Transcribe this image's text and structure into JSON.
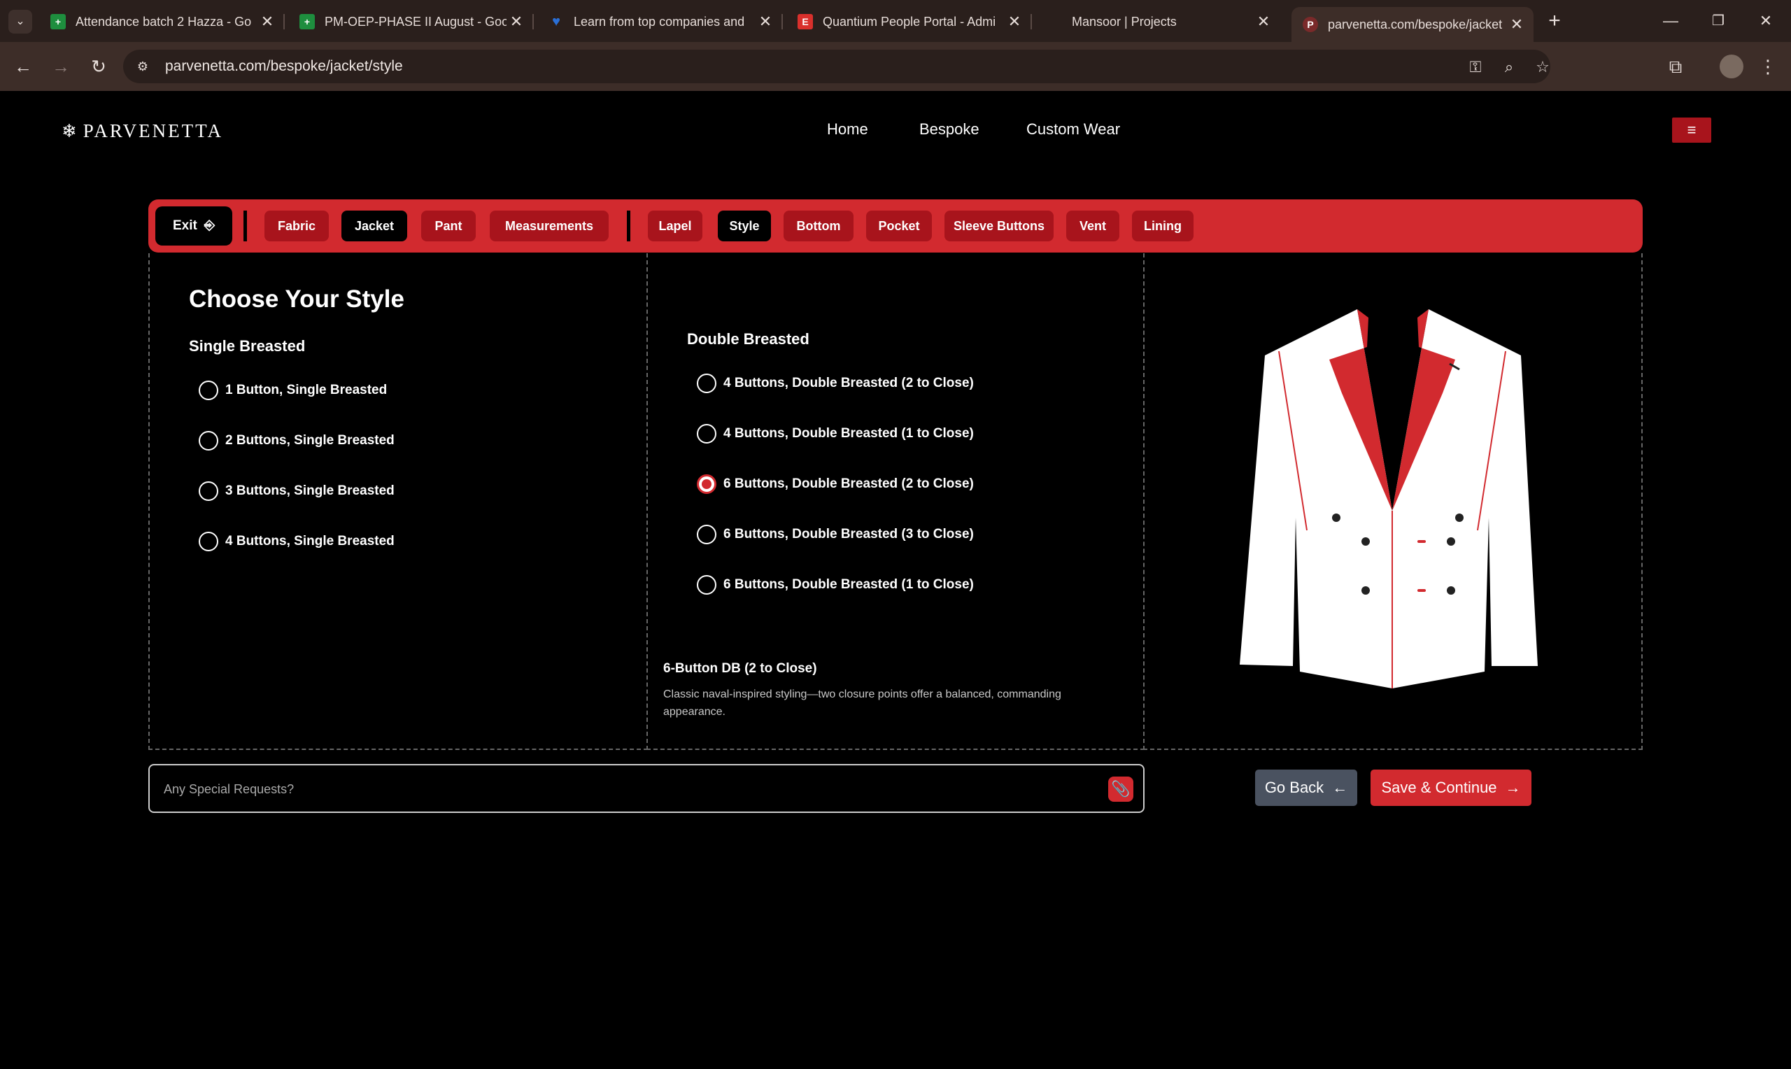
{
  "browser": {
    "tabs": [
      {
        "title": "Attendance batch 2 Hazza - Go",
        "icon": "sheets-icon",
        "color": "#1e8e3e",
        "glyph": "+"
      },
      {
        "title": "PM-OEP-PHASE II August - Goo",
        "icon": "sheets-icon",
        "color": "#1e8e3e",
        "glyph": "+"
      },
      {
        "title": "Learn from top companies and",
        "icon": "heart-icon",
        "color": "#2a6fd6",
        "glyph": "♥"
      },
      {
        "title": "Quantium People Portal - Admi",
        "icon": "e-icon",
        "color": "#d9302c",
        "glyph": "E"
      },
      {
        "title": "Mansoor | Projects",
        "icon": "none",
        "color": "",
        "glyph": ""
      },
      {
        "title": "parvenetta.com/bespoke/jacket",
        "icon": "parvenetta-icon",
        "color": "#c44",
        "glyph": "P"
      }
    ],
    "url": "parvenetta.com/bespoke/jacket/style"
  },
  "site": {
    "logo": "PARVENETTA",
    "nav": [
      "Home",
      "Bespoke",
      "Custom Wear"
    ]
  },
  "steps": {
    "exit": "Exit",
    "main": [
      "Fabric",
      "Jacket",
      "Pant",
      "Measurements"
    ],
    "sub": [
      "Lapel",
      "Style",
      "Bottom",
      "Pocket",
      "Sleeve Buttons",
      "Vent",
      "Lining"
    ],
    "active_main": "Jacket",
    "active_sub": "Style"
  },
  "style_panel": {
    "heading": "Choose Your Style",
    "single_title": "Single Breasted",
    "single_options": [
      "1 Button, Single Breasted",
      "2 Buttons, Single Breasted",
      "3 Buttons, Single Breasted",
      "4 Buttons, Single Breasted"
    ],
    "double_title": "Double Breasted",
    "double_options": [
      "4 Buttons, Double Breasted (2 to Close)",
      "4 Buttons, Double Breasted (1 to Close)",
      "6 Buttons, Double Breasted (2 to Close)",
      "6 Buttons, Double Breasted (3 to Close)",
      "6 Buttons, Double Breasted (1 to Close)"
    ],
    "selected": "6 Buttons, Double Breasted (2 to Close)",
    "description_title": "6-Button DB (2 to Close)",
    "description_text": "Classic naval-inspired styling—two closure points offer a balanced, commanding appearance."
  },
  "footer": {
    "request_placeholder": "Any Special Requests?",
    "go_back": "Go Back",
    "save_continue": "Save & Continue"
  },
  "colors": {
    "accent": "#d22a2f",
    "accent_dark": "#a8141c",
    "jacket_body": "#ffffff",
    "jacket_lapel": "#d22a2f"
  }
}
